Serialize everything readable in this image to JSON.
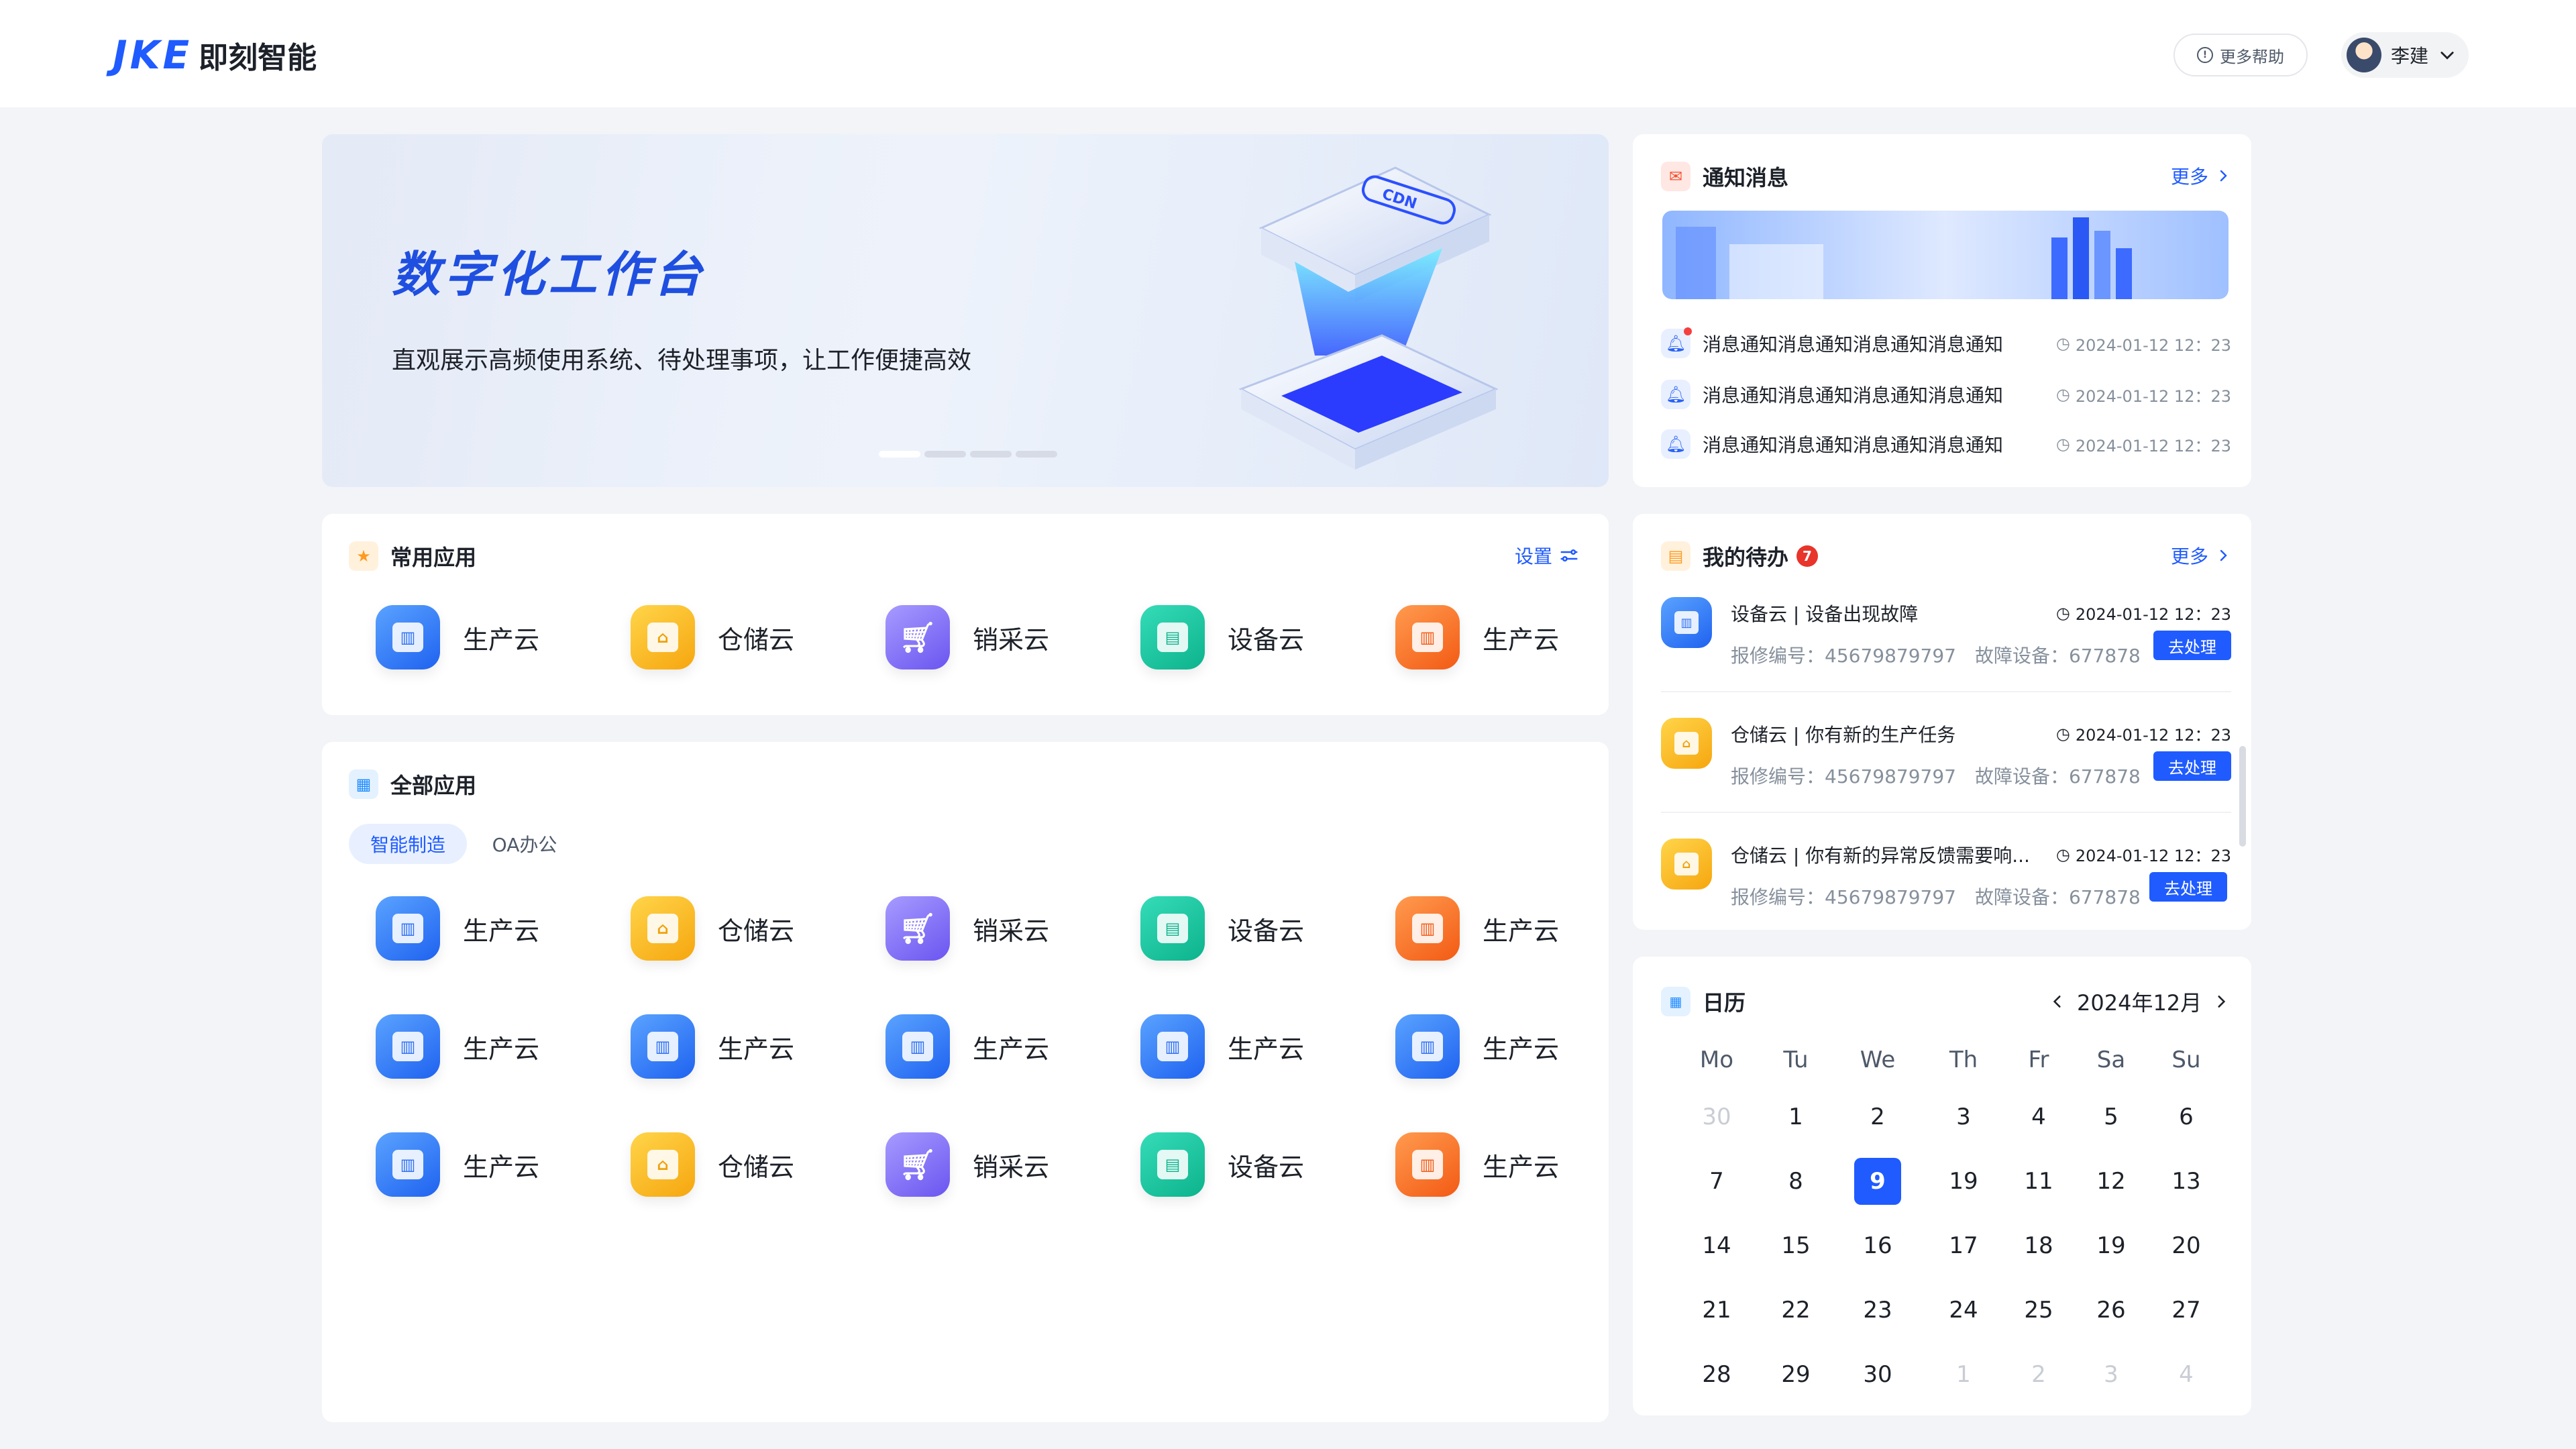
{
  "header": {
    "logo_mark": "JKE",
    "brand_name": "即刻智能",
    "help_label": "更多帮助",
    "user_name": "李建"
  },
  "banner": {
    "title": "数字化工作台",
    "subtitle": "直观展示高频使用系统、待处理事项，让工作便捷高效",
    "graphic_label": "CDN",
    "slide_count": 4,
    "active_slide": 1
  },
  "common_apps": {
    "title": "常用应用",
    "settings_label": "设置",
    "items": [
      {
        "label": "生产云",
        "icon": "production-cloud-icon",
        "color": "#2f6ff5"
      },
      {
        "label": "仓储云",
        "icon": "warehouse-cloud-icon",
        "color": "#f6a60f"
      },
      {
        "label": "销采云",
        "icon": "shopping-cart-icon",
        "color": "#6a55f0"
      },
      {
        "label": "设备云",
        "icon": "device-cloud-icon",
        "color": "#0cb38c"
      },
      {
        "label": "生产云",
        "icon": "production-cloud-icon",
        "color": "#f35a14"
      }
    ]
  },
  "all_apps": {
    "title": "全部应用",
    "tabs": [
      {
        "label": "智能制造",
        "active": true
      },
      {
        "label": "OA办公",
        "active": false
      }
    ],
    "rows": [
      [
        {
          "label": "生产云",
          "icon": "production-cloud-icon",
          "color": "blue"
        },
        {
          "label": "仓储云",
          "icon": "warehouse-cloud-icon",
          "color": "yellow"
        },
        {
          "label": "销采云",
          "icon": "shopping-cart-icon",
          "color": "purple"
        },
        {
          "label": "设备云",
          "icon": "device-cloud-icon",
          "color": "green"
        },
        {
          "label": "生产云",
          "icon": "production-cloud-icon",
          "color": "orange"
        }
      ],
      [
        {
          "label": "生产云",
          "icon": "production-cloud-icon",
          "color": "blue"
        },
        {
          "label": "生产云",
          "icon": "production-cloud-icon",
          "color": "blue"
        },
        {
          "label": "生产云",
          "icon": "production-cloud-icon",
          "color": "blue"
        },
        {
          "label": "生产云",
          "icon": "production-cloud-icon",
          "color": "blue"
        },
        {
          "label": "生产云",
          "icon": "production-cloud-icon",
          "color": "blue"
        }
      ],
      [
        {
          "label": "生产云",
          "icon": "production-cloud-icon",
          "color": "blue"
        },
        {
          "label": "仓储云",
          "icon": "warehouse-cloud-icon",
          "color": "yellow"
        },
        {
          "label": "销采云",
          "icon": "shopping-cart-icon",
          "color": "purple"
        },
        {
          "label": "设备云",
          "icon": "device-cloud-icon",
          "color": "green"
        },
        {
          "label": "生产云",
          "icon": "production-cloud-icon",
          "color": "orange"
        }
      ]
    ]
  },
  "notices": {
    "title": "通知消息",
    "more_label": "更多",
    "items": [
      {
        "text": "消息通知消息通知消息通知消息通知",
        "time": "2024-01-12 12：23",
        "unread": true
      },
      {
        "text": "消息通知消息通知消息通知消息通知",
        "time": "2024-01-12 12：23",
        "unread": false
      },
      {
        "text": "消息通知消息通知消息通知消息通知",
        "time": "2024-01-12 12：23",
        "unread": false
      }
    ]
  },
  "todos": {
    "title": "我的待办",
    "badge": "7",
    "more_label": "更多",
    "items": [
      {
        "title": "设备云 | 设备出现故障",
        "time": "2024-01-12 12：23",
        "meta": "报修编号：45679879797　故障设备：677878",
        "action": "去处理",
        "color": "blue"
      },
      {
        "title": "仓储云 | 你有新的生产任务",
        "time": "2024-01-12 12：23",
        "meta": "报修编号：45679879797　故障设备：677878",
        "action": "去处理",
        "color": "yellow"
      },
      {
        "title": "仓储云 | 你有新的异常反馈需要响...",
        "time": "2024-01-12 12：23",
        "meta": "报修编号：45679879797　故障设备：677878",
        "action": "去处理",
        "color": "yellow"
      }
    ]
  },
  "calendar": {
    "title": "日历",
    "month_label": "2024年12月",
    "weekdays": [
      "Mo",
      "Tu",
      "We",
      "Th",
      "Fr",
      "Sa",
      "Su"
    ],
    "weeks": [
      [
        {
          "d": "30",
          "m": true
        },
        {
          "d": "1"
        },
        {
          "d": "2"
        },
        {
          "d": "3"
        },
        {
          "d": "4"
        },
        {
          "d": "5"
        },
        {
          "d": "6"
        }
      ],
      [
        {
          "d": "7"
        },
        {
          "d": "8"
        },
        {
          "d": "9",
          "sel": true
        },
        {
          "d": "19"
        },
        {
          "d": "11"
        },
        {
          "d": "12"
        },
        {
          "d": "13"
        }
      ],
      [
        {
          "d": "14"
        },
        {
          "d": "15"
        },
        {
          "d": "16"
        },
        {
          "d": "17"
        },
        {
          "d": "18"
        },
        {
          "d": "19"
        },
        {
          "d": "20"
        }
      ],
      [
        {
          "d": "21"
        },
        {
          "d": "22"
        },
        {
          "d": "23"
        },
        {
          "d": "24"
        },
        {
          "d": "25"
        },
        {
          "d": "26"
        },
        {
          "d": "27"
        }
      ],
      [
        {
          "d": "28"
        },
        {
          "d": "29"
        },
        {
          "d": "30"
        },
        {
          "d": "1",
          "m": true
        },
        {
          "d": "2",
          "m": true
        },
        {
          "d": "3",
          "m": true
        },
        {
          "d": "4",
          "m": true
        }
      ]
    ]
  }
}
